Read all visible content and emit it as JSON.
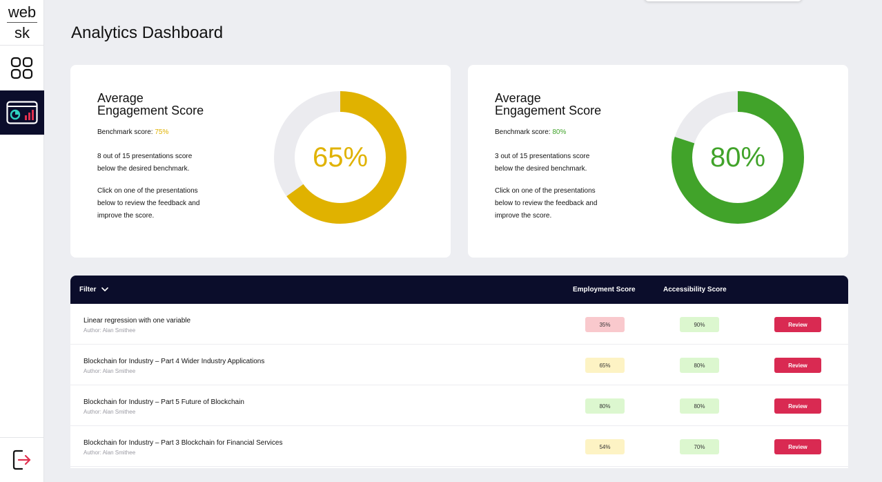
{
  "app": {
    "logo_line1": "web",
    "logo_line2": "sk"
  },
  "sidebar": {
    "items": [
      {
        "icon": "grid-icon",
        "active": false
      },
      {
        "icon": "analytics-icon",
        "active": true
      }
    ],
    "logout_icon": "logout-icon"
  },
  "page": {
    "title": "Analytics Dashboard"
  },
  "cards": [
    {
      "title_line1": "Average",
      "title_line2": "Engagement Score",
      "benchmark_prefix": "Benchmark score: ",
      "benchmark_value": "75%",
      "summary_line1": "8 out of 15 presentations score",
      "summary_line2": "below the desired benchmark.",
      "cta_line1": "Click on one of the presentations",
      "cta_line2": "below to review the feedback and",
      "cta_line3": "improve the score.",
      "score_label": "65%",
      "score_fraction": 0.65,
      "color": "#e0b200"
    },
    {
      "title_line1": "Average",
      "title_line2": "Engagement Score",
      "benchmark_prefix": "Benchmark score: ",
      "benchmark_value": "80%",
      "summary_line1": "3 out of 15 presentations score",
      "summary_line2": "below the desired benchmark.",
      "cta_line1": "Click on one of the presentations",
      "cta_line2": "below to review the feedback and",
      "cta_line3": "improve the score.",
      "score_label": "80%",
      "score_fraction": 0.8,
      "color": "#41a32a"
    }
  ],
  "table": {
    "filter_label": "Filter",
    "columns": {
      "employment": "Employment Score",
      "accessibility": "Accessibility Score"
    },
    "review_label": "Review",
    "rows": [
      {
        "title": "Linear regression with one variable",
        "author": "Author: Alan Smithee",
        "employment": "35%",
        "employment_status": "low",
        "accessibility": "90%",
        "accessibility_status": "good"
      },
      {
        "title": "Blockchain for Industry – Part 4 Wider Industry Applications",
        "author": "Author: Alan Smithee",
        "employment": "65%",
        "employment_status": "medium",
        "accessibility": "80%",
        "accessibility_status": "good"
      },
      {
        "title": "Blockchain for Industry – Part 5 Future of Blockchain",
        "author": "Author: Alan Smithee",
        "employment": "80%",
        "employment_status": "good",
        "accessibility": "80%",
        "accessibility_status": "good"
      },
      {
        "title": "Blockchain for Industry – Part 3 Blockchain for Financial Services",
        "author": "Author: Alan Smithee",
        "employment": "54%",
        "employment_status": "medium",
        "accessibility": "70%",
        "accessibility_status": "good"
      }
    ]
  },
  "colors": {
    "navy": "#0b0d2b",
    "review": "#d92a52",
    "pill_low": "#f9c9cd",
    "pill_medium": "#fdf3c4",
    "pill_good": "#dcf7cf",
    "donut_track": "#ebebef"
  }
}
